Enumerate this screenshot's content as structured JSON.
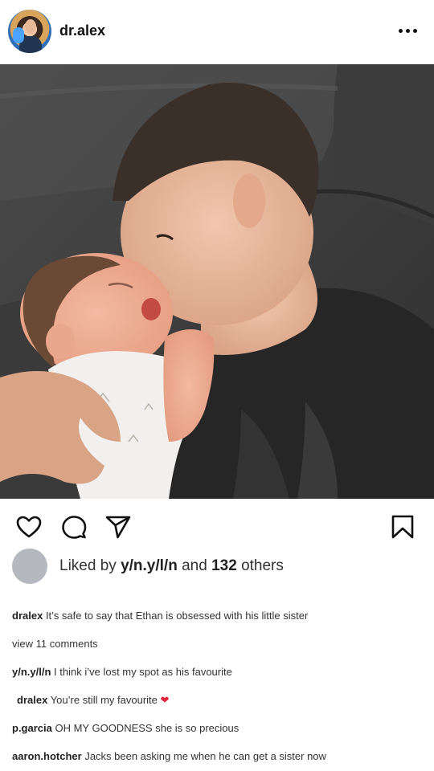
{
  "post": {
    "username": "dr.alex",
    "likes": {
      "prefix": "Liked by",
      "user": "y/n.y/l/n",
      "middle": "and",
      "count": "132",
      "suffix": "others"
    },
    "caption": {
      "user": "dralex",
      "text": "It’s safe to say that Ethan is obsessed with his little sister"
    },
    "view_comments": "view 11 comments",
    "comments": [
      {
        "user": "y/n.y/l/n",
        "text": "I think i’ve lost my spot as his favourite"
      },
      {
        "user": "dralex",
        "text": "You’re still my favourite",
        "emoji": "❤"
      },
      {
        "user": "p.garcia",
        "text": "OH MY GOODNESS she is so precious"
      },
      {
        "user": "aaron.hotcher",
        "text": "Jacks been asking me when he can get a sister now"
      }
    ]
  },
  "icons": {
    "more": "more-horizontal-icon",
    "like": "heart-icon",
    "comment": "comment-bubble-icon",
    "share": "send-icon",
    "save": "bookmark-icon"
  },
  "colors": {
    "background": "#ffffff",
    "text": "#262626",
    "heart_emoji": "#e0243b",
    "likes_avatar": "#b5b8bf"
  }
}
